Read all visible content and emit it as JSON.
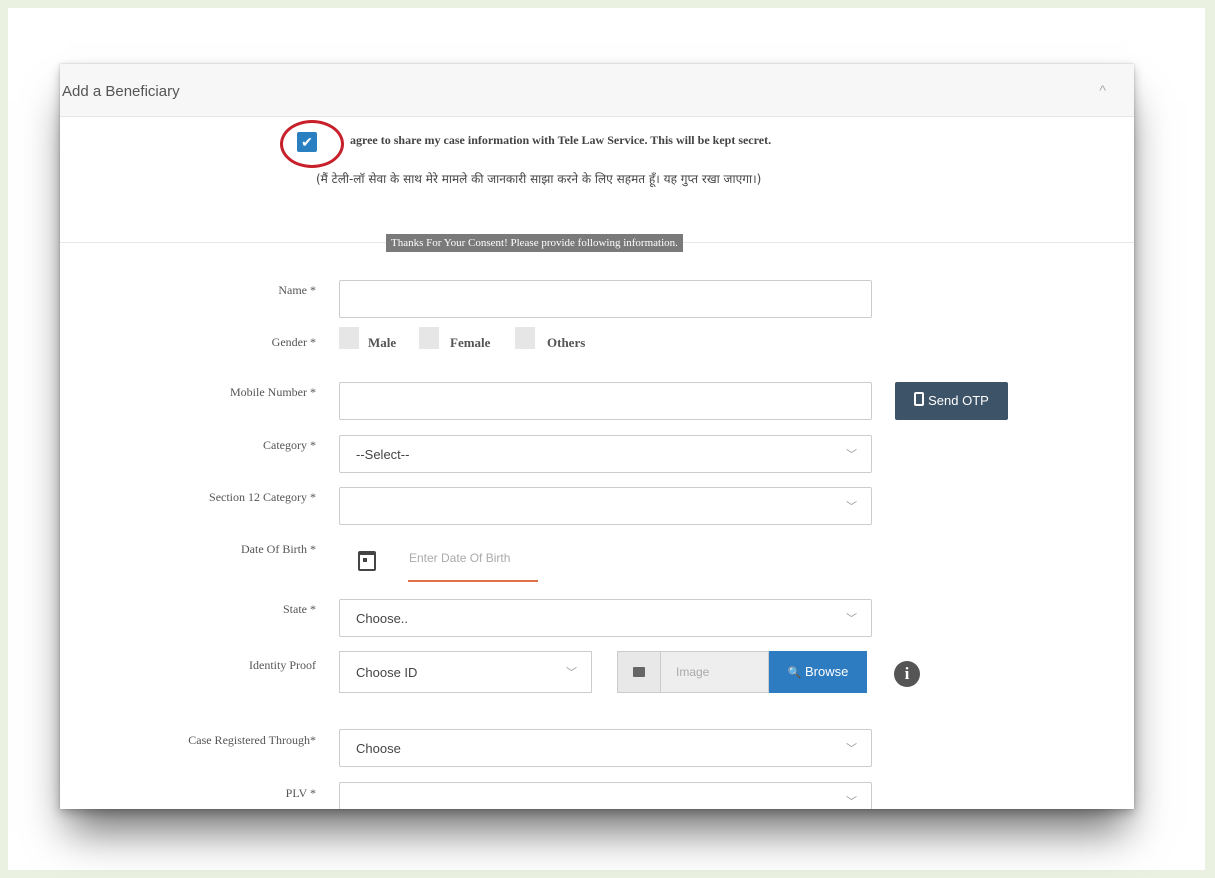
{
  "card": {
    "title": "Add a Beneficiary",
    "collapse_icon": "^"
  },
  "consent": {
    "checked": true,
    "check_glyph": "✔",
    "english": "agree to share my case information with Tele Law Service. This will be kept secret.",
    "hindi": "(मैं टेली-लॉ सेवा के साथ मेरे मामले की जानकारी साझा करने के लिए सहमत हूँ। यह गुप्त रखा जाएगा।)",
    "thanks": "Thanks For Your Consent! Please provide following information."
  },
  "form": {
    "name": {
      "label": "Name *",
      "value": ""
    },
    "gender": {
      "label": "Gender *",
      "options": [
        "Male",
        "Female",
        "Others"
      ]
    },
    "mobile": {
      "label": "Mobile Number *",
      "value": "",
      "send_otp": "Send OTP"
    },
    "category": {
      "label": "Category *",
      "value": "--Select--"
    },
    "section12": {
      "label": "Section 12 Category *",
      "value": ""
    },
    "dob": {
      "label": "Date Of Birth *",
      "placeholder": "Enter Date Of Birth"
    },
    "state": {
      "label": "State *",
      "value": "Choose.."
    },
    "identity": {
      "label": "Identity Proof",
      "value": "Choose ID",
      "image_placeholder": "Image",
      "browse": "Browse",
      "info_glyph": "i"
    },
    "registered_through": {
      "label": "Case Registered Through*",
      "value": "Choose"
    },
    "plv": {
      "label": "PLV *",
      "value": ""
    }
  },
  "icons": {
    "chevron": "﹀",
    "search": "🔍"
  },
  "colors": {
    "accent_blue": "#2d7cc2",
    "otp_button": "#3d5368",
    "highlight_circle": "#c8202a",
    "dob_underline": "#e07048"
  }
}
